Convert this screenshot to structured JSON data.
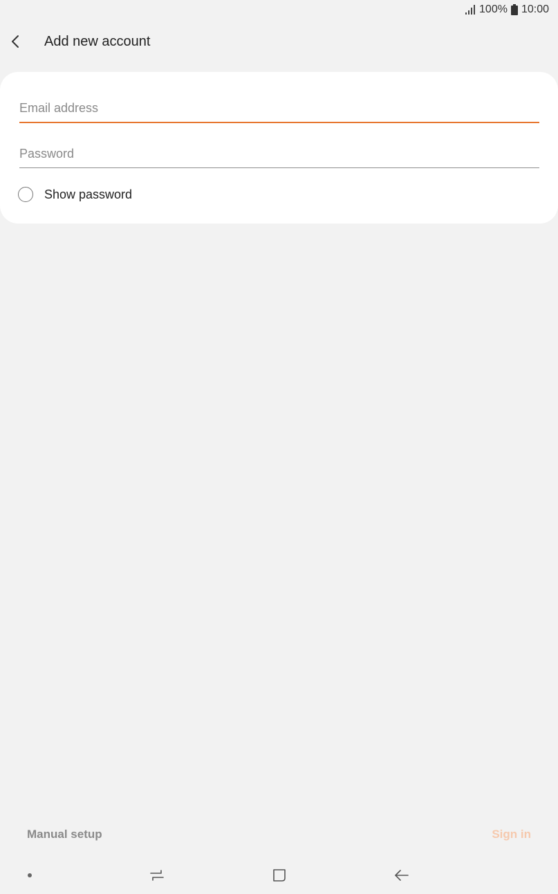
{
  "status_bar": {
    "battery": "100%",
    "time": "10:00"
  },
  "header": {
    "title": "Add new account"
  },
  "form": {
    "email_placeholder": "Email address",
    "email_value": "",
    "password_placeholder": "Password",
    "password_value": "",
    "show_password_label": "Show password"
  },
  "actions": {
    "manual_setup": "Manual setup",
    "sign_in": "Sign in"
  },
  "colors": {
    "accent": "#e7762f",
    "sign_in_disabled": "#f6c9ad",
    "background": "#f2f2f2"
  },
  "icons": {
    "status": [
      "signal-icon",
      "battery-icon"
    ],
    "header": [
      "chevron-left-icon"
    ],
    "nav": [
      "dot-icon",
      "recent-apps-icon",
      "home-icon",
      "back-arrow-icon"
    ]
  }
}
